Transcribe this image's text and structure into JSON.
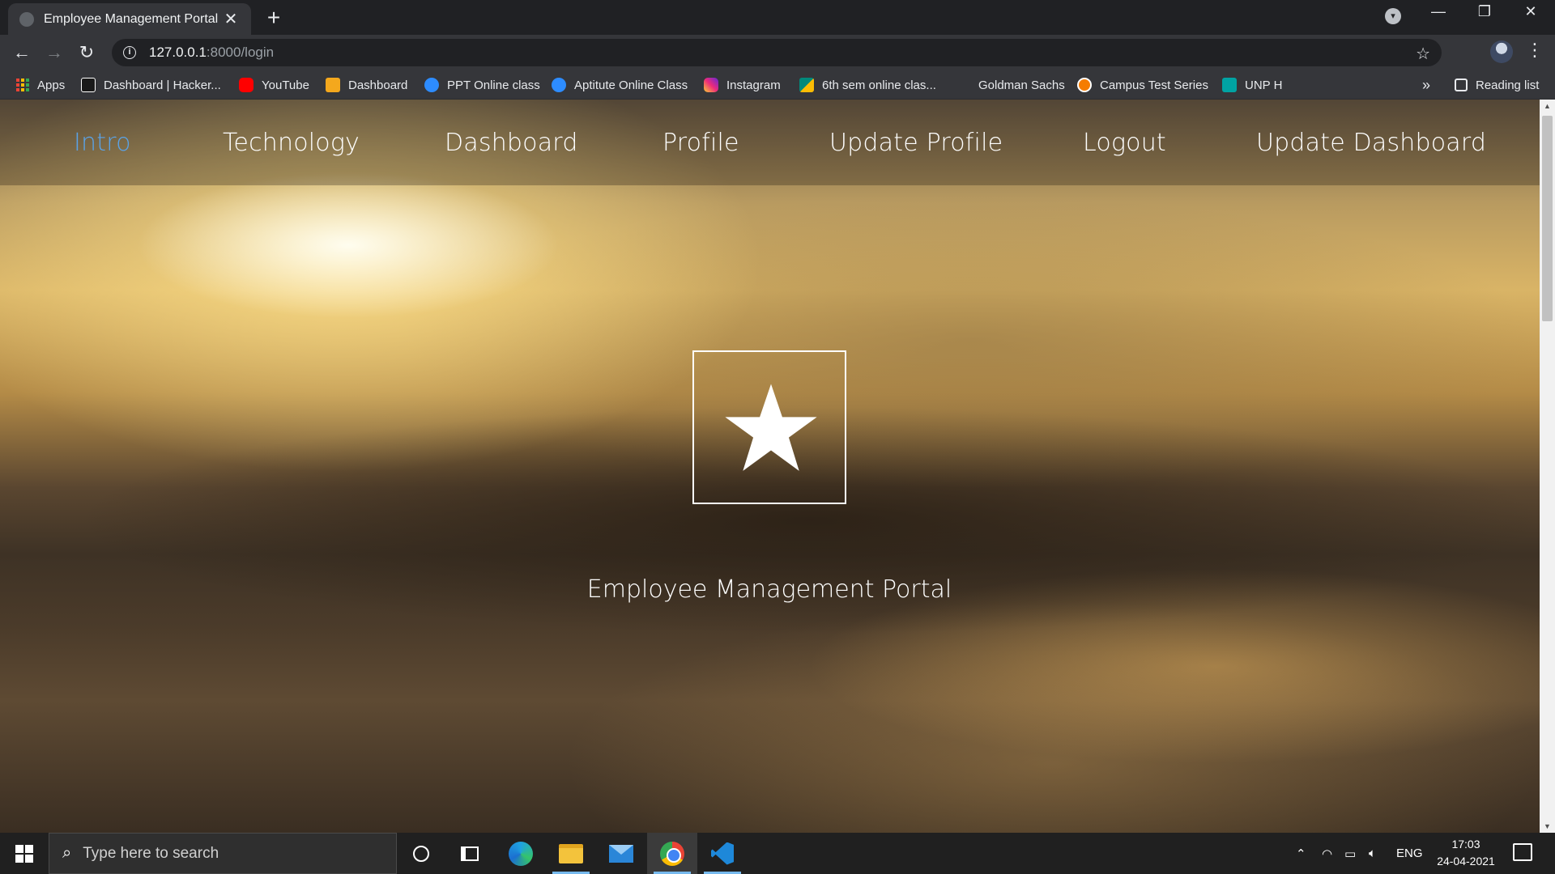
{
  "browser": {
    "tab_title": "Employee Management Portal",
    "tab_close": "✕",
    "new_tab": "+",
    "url_host": "127.0.0.1",
    "url_path": ":8000/login",
    "bookmarks": [
      {
        "label": "Apps",
        "icon": "apps-grid-icon",
        "color": "#8ab4f8"
      },
      {
        "label": "Dashboard | Hacker...",
        "icon": "hackerearth-icon",
        "color": "#1a1a1a"
      },
      {
        "label": "YouTube",
        "icon": "youtube-icon",
        "color": "#ff0000"
      },
      {
        "label": "Dashboard",
        "icon": "dashboard-icon",
        "color": "#f4a81d"
      },
      {
        "label": "PPT Online class",
        "icon": "zoom-icon",
        "color": "#2d8cff"
      },
      {
        "label": "Aptitute Online Class",
        "icon": "zoom-icon",
        "color": "#2d8cff"
      },
      {
        "label": "Instagram",
        "icon": "instagram-icon",
        "color": "#d6249f"
      },
      {
        "label": "6th sem online clas...",
        "icon": "google-meet-icon",
        "color": "#00897b"
      },
      {
        "label": "Goldman Sachs",
        "icon": "",
        "color": ""
      },
      {
        "label": "Campus Test Series",
        "icon": "campus-icon",
        "color": "#f57c00"
      },
      {
        "label": "UNP H",
        "icon": "unp-icon",
        "color": "#00a3a3"
      }
    ],
    "bookmarks_more": "»",
    "reading_list": "Reading list"
  },
  "page": {
    "nav": [
      {
        "label": "Intro",
        "active": true
      },
      {
        "label": "Technology",
        "active": false
      },
      {
        "label": "Dashboard",
        "active": false
      },
      {
        "label": "Profile",
        "active": false
      },
      {
        "label": "Update Profile",
        "active": false
      },
      {
        "label": "Logout",
        "active": false
      },
      {
        "label": "Update Dashboard",
        "active": false
      }
    ],
    "hero_icon": "star-icon",
    "hero_title": "Employee Management Portal",
    "active_color": "#5aa3e8"
  },
  "taskbar": {
    "search_placeholder": "Type here to search",
    "language": "ENG",
    "time": "17:03",
    "date": "24-04-2021"
  }
}
